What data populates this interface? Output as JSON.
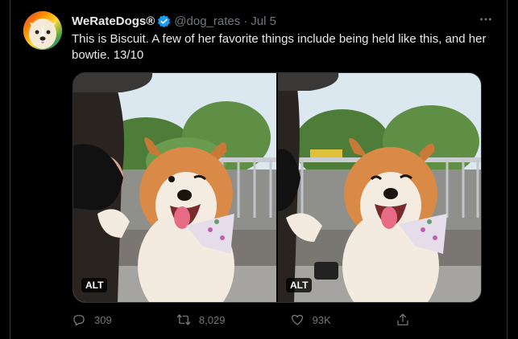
{
  "tweet": {
    "display_name": "WeRateDogs®",
    "handle": "@dog_rates",
    "separator": "·",
    "date": "Jul 5",
    "text": "This is Biscuit. A few of her favorite things include being held like this, and her bowtie. 13/10",
    "more_icon": "more-horizontal-icon",
    "verified_icon": "verified-badge-icon",
    "verified_color": "#1d9bf0"
  },
  "media": {
    "photos": [
      {
        "alt_label": "ALT"
      },
      {
        "alt_label": "ALT"
      }
    ]
  },
  "actions": {
    "replies": "309",
    "retweets": "8,029",
    "likes": "93K",
    "icons": [
      "reply-icon",
      "retweet-icon",
      "like-icon",
      "share-icon"
    ]
  },
  "colors": {
    "background": "#000000",
    "text": "#e7e9ea",
    "secondary": "#71767b",
    "border": "#2f3336"
  }
}
